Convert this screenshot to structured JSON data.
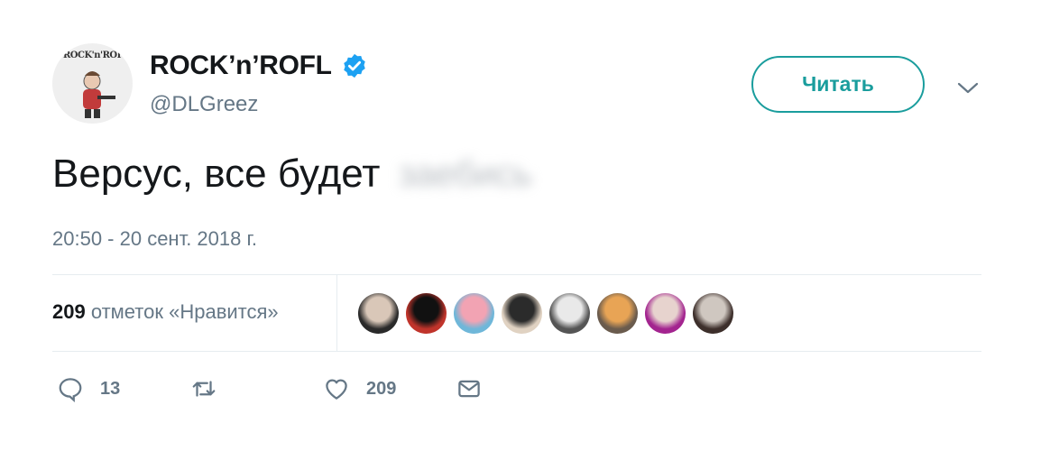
{
  "user": {
    "display_name": "ROCK’n’ROFL",
    "handle": "@DLGreez",
    "avatar_logo_text": "ROCK'n'ROFL",
    "verified": true
  },
  "follow_button": {
    "label": "Читать"
  },
  "tweet": {
    "text": "Версус, все будет",
    "text_blurred": "заебись",
    "timestamp": "20:50 - 20 сент. 2018 г."
  },
  "likes": {
    "count": "209",
    "label": "отметок «Нравится»",
    "avatars": [
      {
        "name": "liker-1",
        "colors": [
          "#d9c7b8",
          "#2a2a2a"
        ]
      },
      {
        "name": "liker-2",
        "colors": [
          "#111111",
          "#c0342b"
        ]
      },
      {
        "name": "liker-3",
        "colors": [
          "#f2a3b3",
          "#6fb7d9"
        ]
      },
      {
        "name": "liker-4",
        "colors": [
          "#2b2b2b",
          "#e0d2c2"
        ]
      },
      {
        "name": "liker-5",
        "colors": [
          "#e9e9e9",
          "#555555"
        ]
      },
      {
        "name": "liker-6",
        "colors": [
          "#e8a455",
          "#6a5b4d"
        ]
      },
      {
        "name": "liker-7",
        "colors": [
          "#e7d3ce",
          "#a3248f"
        ]
      },
      {
        "name": "liker-8",
        "colors": [
          "#cfc7c0",
          "#3d2f2b"
        ]
      }
    ]
  },
  "actions": {
    "reply_count": "13",
    "retweet_count": "",
    "like_count": "209"
  },
  "colors": {
    "accent": "#1a9d9d",
    "verified": "#1da1f2",
    "muted": "#657786"
  }
}
